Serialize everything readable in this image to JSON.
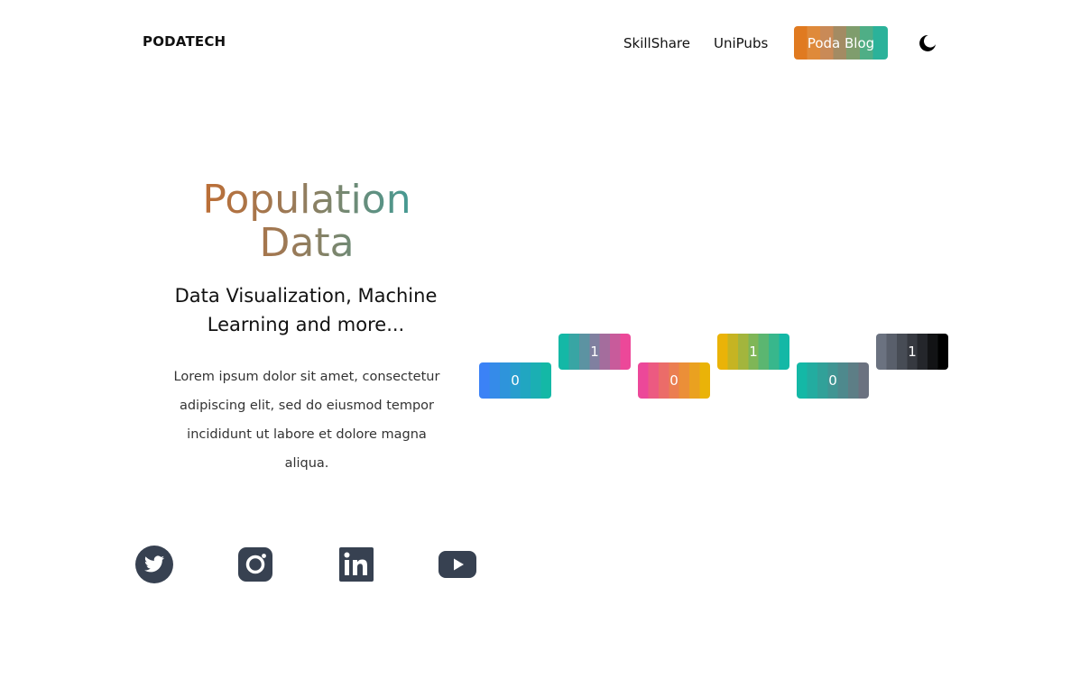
{
  "header": {
    "brand": "PODATECH",
    "nav": {
      "skillshare": "SkillShare",
      "unipubs": "UniPubs",
      "blog": "Poda Blog"
    },
    "theme_icon": "moon-icon"
  },
  "hero": {
    "title_line1": "Population",
    "title_line2": "Data",
    "subtitle_line1": "Data Visualization, Machine",
    "subtitle_line2": "Learning and more...",
    "body": "Lorem ipsum dolor sit amet, consectetur adipiscing elit, sed do eiusmod tempor incididunt ut labore et dolore magna aliqua."
  },
  "tiles": [
    {
      "value": "0",
      "colors": [
        "#3b82f6",
        "#14b8a6"
      ]
    },
    {
      "value": "1",
      "colors": [
        "#14b8a6",
        "#ec4899"
      ]
    },
    {
      "value": "0",
      "colors": [
        "#ec4899",
        "#eab308"
      ]
    },
    {
      "value": "1",
      "colors": [
        "#eab308",
        "#14b8a6"
      ]
    },
    {
      "value": "0",
      "colors": [
        "#14b8a6",
        "#6b7280"
      ]
    },
    {
      "value": "1",
      "colors": [
        "#6b7280",
        "#000000"
      ]
    }
  ],
  "social": [
    {
      "name": "twitter-icon"
    },
    {
      "name": "instagram-icon"
    },
    {
      "name": "linkedin-icon"
    },
    {
      "name": "youtube-icon"
    }
  ],
  "colors": {
    "icon": "#374151",
    "text": "#111111"
  }
}
